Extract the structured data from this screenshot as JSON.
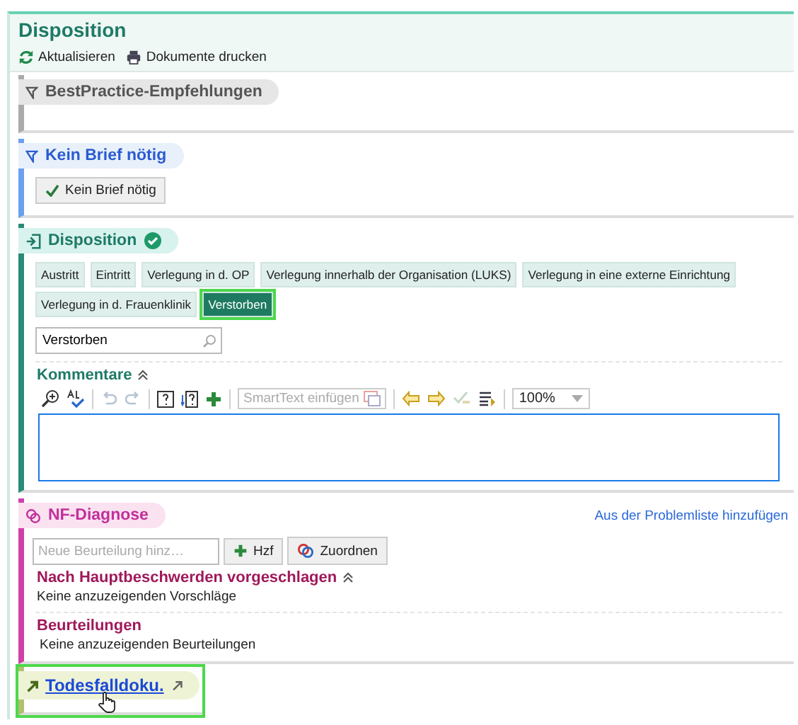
{
  "panel": {
    "title": "Disposition",
    "toolbar": [
      {
        "label": "Aktualisieren",
        "kind": "refresh"
      },
      {
        "label": "Dokumente drucken",
        "kind": "print"
      }
    ]
  },
  "bestpractice": {
    "title": "BestPractice-Empfehlungen"
  },
  "kein_brief": {
    "title": "Kein Brief nötig",
    "button": {
      "label": "Kein Brief nötig",
      "checked": true
    }
  },
  "disposition": {
    "title": "Disposition",
    "complete": true,
    "options": [
      {
        "label": "Austritt",
        "selected": false
      },
      {
        "label": "Eintritt",
        "selected": false
      },
      {
        "label": "Verlegung in d. OP",
        "selected": false
      },
      {
        "label": "Verlegung innerhalb der Organisation (LUKS)",
        "selected": false
      },
      {
        "label": "Verlegung in eine externe Einrichtung",
        "selected": false
      },
      {
        "label": "Verlegung in d. Frauenklinik",
        "selected": false
      },
      {
        "label": "Verstorben",
        "selected": true
      }
    ],
    "search": {
      "value": "Verstorben"
    },
    "comments": {
      "title": "Kommentare",
      "expanded": true,
      "smarttext_placeholder": "SmartText einfügen",
      "zoom": "100%"
    }
  },
  "nf_diagnose": {
    "title": "NF-Diagnose",
    "link": "Aus der Problemliste hinzufügen",
    "input_placeholder": "Neue Beurteilung hinz…",
    "buttons": [
      {
        "label": "Hzf",
        "kind": "add"
      },
      {
        "label": "Zuordnen",
        "kind": "assign"
      }
    ],
    "suggested": {
      "title": "Nach Hauptbeschwerden vorgeschlagen",
      "expanded": true,
      "empty": "Keine anzuzeigenden Vorschläge"
    },
    "assessments": {
      "title": "Beurteilungen",
      "empty": "Keine anzuzeigenden Beurteilungen"
    }
  },
  "todesfall": {
    "title": "Todesfalldoku.",
    "highlighted": true
  }
}
